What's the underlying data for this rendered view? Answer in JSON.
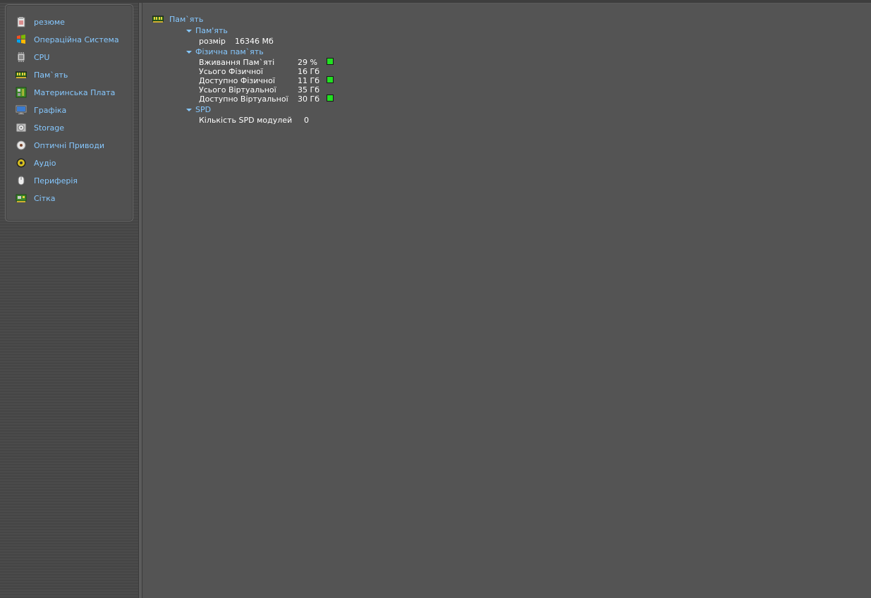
{
  "sidebar": {
    "items": [
      {
        "label": "резюме",
        "icon": "summary-clipboard-icon"
      },
      {
        "label": "Операційна Система",
        "icon": "windows-logo-icon"
      },
      {
        "label": "CPU",
        "icon": "cpu-chip-icon"
      },
      {
        "label": "Пам`ять",
        "icon": "ram-module-icon"
      },
      {
        "label": "Материнська Плата",
        "icon": "motherboard-icon"
      },
      {
        "label": "Графіка",
        "icon": "monitor-icon"
      },
      {
        "label": "Storage",
        "icon": "hard-drive-icon"
      },
      {
        "label": "Оптичні Приводи",
        "icon": "optical-disc-icon"
      },
      {
        "label": "Аудіо",
        "icon": "speaker-icon"
      },
      {
        "label": "Периферія",
        "icon": "mouse-icon"
      },
      {
        "label": "Сітка",
        "icon": "network-card-icon"
      }
    ]
  },
  "main": {
    "root_label": "Пам`ять",
    "sections": {
      "memory": {
        "title": "Пам'ять",
        "props": [
          {
            "label": "розмір",
            "value": "16346 Мб"
          }
        ]
      },
      "physical": {
        "title": "Фізична пам`ять",
        "props": [
          {
            "label": "Вживання Пам`яті",
            "value": "29 %"
          },
          {
            "label": "Усього Фізичної",
            "value": "16 Гб"
          },
          {
            "label": "Доступно Фізичної",
            "value": "11 Гб"
          },
          {
            "label": "Усього Віртуальної",
            "value": "35 Гб"
          },
          {
            "label": "Доступно Віртуальної",
            "value": "30 Гб"
          }
        ]
      },
      "spd": {
        "title": "SPD",
        "props": [
          {
            "label": "Кількість SPD модулей",
            "value": "0"
          }
        ]
      }
    }
  },
  "colors": {
    "link": "#86c8ff",
    "indicator": "#22e022",
    "background": "#545454"
  }
}
